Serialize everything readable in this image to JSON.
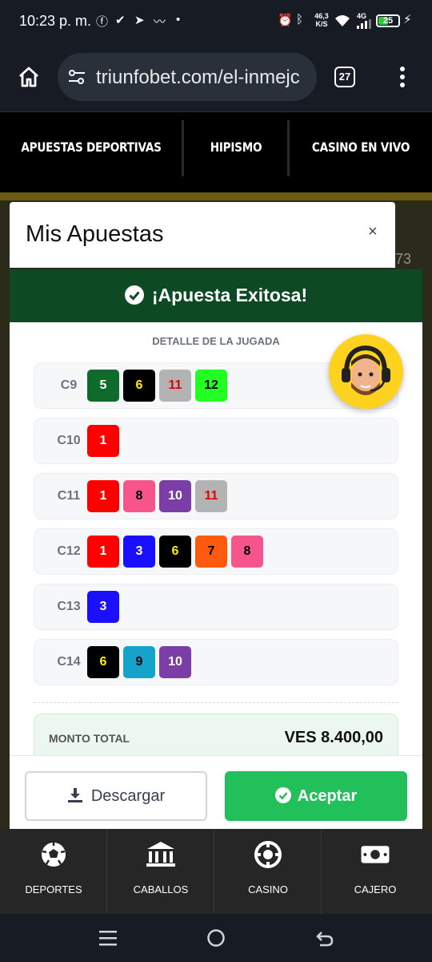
{
  "status_bar": {
    "time": "10:23 p. m.",
    "network_speed_top": "46,3",
    "network_speed_unit": "K/S",
    "signal_label": "4G",
    "battery": "25"
  },
  "browser": {
    "url": "triunfobet.com/el-inmejc",
    "tab_count": "27"
  },
  "site_nav": [
    "APUESTAS DEPORTIVAS",
    "HIPISMO",
    "CASINO EN VIVO"
  ],
  "background_number": "73",
  "modal": {
    "title": "Mis Apuestas",
    "close": "×",
    "success": "¡Apuesta Exitosa!",
    "detail_title": "DETALLE DE LA JUGADA",
    "rows": [
      {
        "race": "C9",
        "picks": [
          "5",
          "6",
          "11",
          "12"
        ]
      },
      {
        "race": "C10",
        "picks": [
          "1"
        ]
      },
      {
        "race": "C11",
        "picks": [
          "1",
          "8",
          "10",
          "11"
        ]
      },
      {
        "race": "C12",
        "picks": [
          "1",
          "3",
          "6",
          "7",
          "8"
        ]
      },
      {
        "race": "C13",
        "picks": [
          "3"
        ]
      },
      {
        "race": "C14",
        "picks": [
          "6",
          "9",
          "10"
        ]
      }
    ],
    "total_label": "MONTO TOTAL",
    "total_value": "VES 8.400,00",
    "download_label": "Descargar",
    "accept_label": "Aceptar"
  },
  "bottom_nav": [
    "DEPORTES",
    "CABALLOS",
    "CASINO",
    "CAJERO"
  ],
  "colors": {
    "success_banner": "#0d4a24",
    "accept_button": "#22c05a",
    "avatar_bg": "#ffd21f",
    "saddle_cloths": {
      "1": {
        "bg": "#ff0000",
        "fg": "#ffffff"
      },
      "3": {
        "bg": "#1a10ff",
        "fg": "#ffffff"
      },
      "5": {
        "bg": "#0f6b2c",
        "fg": "#ffffff"
      },
      "6": {
        "bg": "#000000",
        "fg": "#ffee00"
      },
      "7": {
        "bg": "#ff5a10",
        "fg": "#000000"
      },
      "8": {
        "bg": "#f5558a",
        "fg": "#000000"
      },
      "9": {
        "bg": "#15a3c9",
        "fg": "#000000"
      },
      "10": {
        "bg": "#7a3ea6",
        "fg": "#ffffff"
      },
      "11": {
        "bg": "#b3b3b3",
        "fg": "#e00000"
      },
      "12": {
        "bg": "#22ff22",
        "fg": "#000000"
      }
    }
  },
  "icons": [
    "home-icon",
    "tune-icon",
    "more-vert-icon",
    "check-circle-icon",
    "download-icon",
    "soccer-ball-icon",
    "bank-icon",
    "casino-chip-icon",
    "cash-icon"
  ]
}
